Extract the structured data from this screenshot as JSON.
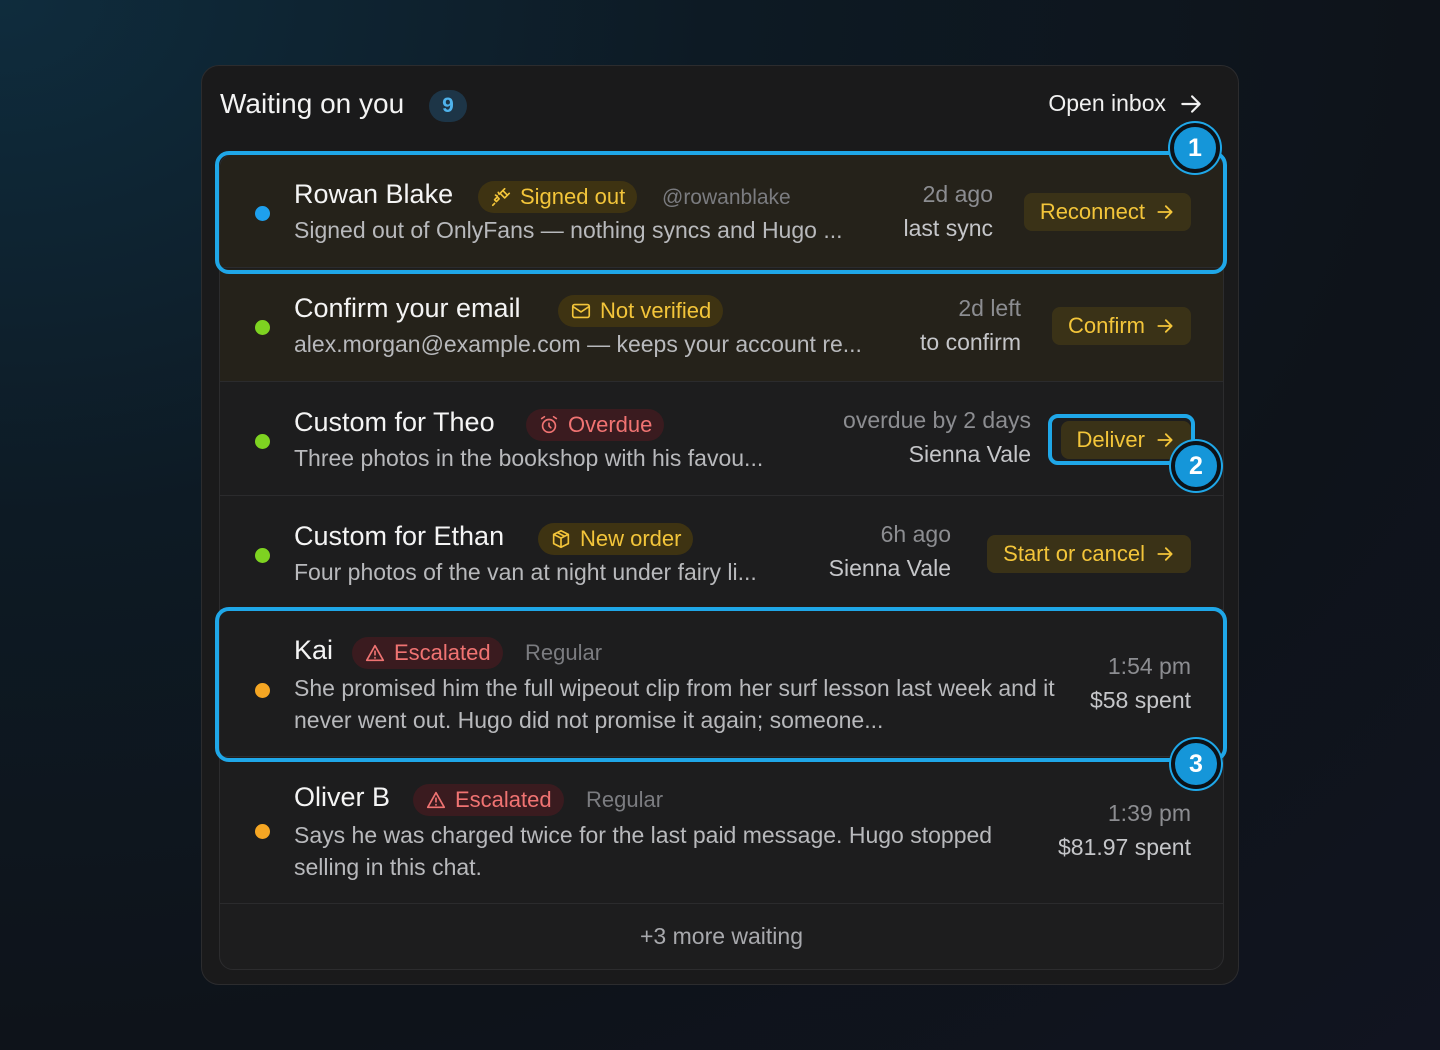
{
  "header": {
    "title": "Waiting on you",
    "count": "9",
    "open_inbox": "Open inbox"
  },
  "rows": [
    {
      "name": "Rowan Blake",
      "tag": "Signed out",
      "handle": "@rowanblake",
      "summary": "Signed out of OnlyFans — nothing syncs and Hugo ...",
      "meta_top": "2d ago",
      "meta_bottom": "last sync",
      "action": "Reconnect",
      "dot_color": "#1ea0ee"
    },
    {
      "name": "Confirm your email",
      "tag": "Not verified",
      "summary": "alex.morgan@example.com — keeps your account re...",
      "meta_top": "2d left",
      "meta_bottom": "to confirm",
      "action": "Confirm",
      "dot_color": "#7ed321"
    },
    {
      "name": "Custom for Theo",
      "tag": "Overdue",
      "summary": "Three photos in the bookshop with his favou...",
      "meta_top": "overdue by 2 days",
      "meta_bottom": "Sienna Vale",
      "action": "Deliver",
      "dot_color": "#7ed321"
    },
    {
      "name": "Custom for Ethan",
      "tag": "New order",
      "summary": "Four photos of the van at night under fairy li...",
      "meta_top": "6h ago",
      "meta_bottom": "Sienna Vale",
      "action": "Start or cancel",
      "dot_color": "#7ed321"
    },
    {
      "name": "Kai",
      "tag": "Escalated",
      "segment": "Regular",
      "summary": "She promised him the full wipeout clip from her surf lesson last week and it never went out. Hugo did not promise it again; someone...",
      "meta_top": "1:54 pm",
      "meta_bottom": "$58 spent",
      "dot_color": "#f5a623"
    },
    {
      "name": "Oliver B",
      "tag": "Escalated",
      "segment": "Regular",
      "summary": "Says he was charged twice for the last paid message. Hugo stopped selling in this chat.",
      "meta_top": "1:39 pm",
      "meta_bottom": "$81.97 spent",
      "dot_color": "#f5a623"
    }
  ],
  "footer": {
    "more": "+3 more waiting"
  },
  "markers": [
    "1",
    "2",
    "3"
  ],
  "colors": {
    "accent": "#1fa7e8",
    "amber": "#f3c53a",
    "red": "#f07372",
    "panel": "#1a1a1b"
  }
}
